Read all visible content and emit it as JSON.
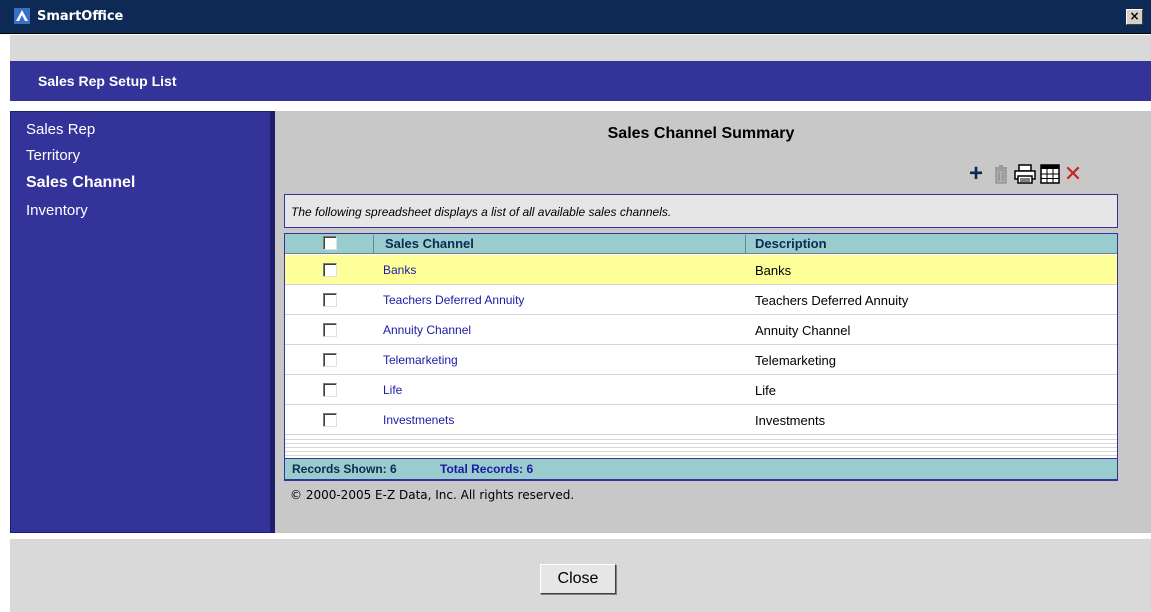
{
  "window": {
    "title": "SmartOffice",
    "close_glyph": "×"
  },
  "header": {
    "title": "Sales Rep Setup List"
  },
  "sidebar": {
    "items": [
      {
        "label": "Sales Rep",
        "active": false
      },
      {
        "label": "Territory",
        "active": false
      },
      {
        "label": "Sales Channel",
        "active": true
      },
      {
        "label": "Inventory",
        "active": false
      }
    ]
  },
  "main": {
    "title": "Sales Channel Summary",
    "toolbar": {
      "icons": [
        "add-icon",
        "trash-icon",
        "print-icon",
        "grid-icon",
        "delete-icon"
      ],
      "add_glyph": "+",
      "delete_glyph": "✕"
    },
    "info_text": "The following spreadsheet displays a list of all available sales channels."
  },
  "grid": {
    "columns": [
      "Sales Channel",
      "Description"
    ],
    "rows": [
      {
        "name": "Banks",
        "description": "Banks",
        "selected": true
      },
      {
        "name": "Teachers Deferred Annuity",
        "description": "Teachers Deferred Annuity",
        "selected": false
      },
      {
        "name": "Annuity Channel",
        "description": "Annuity Channel",
        "selected": false
      },
      {
        "name": "Telemarketing",
        "description": "Telemarketing",
        "selected": false
      },
      {
        "name": "Life",
        "description": "Life",
        "selected": false
      },
      {
        "name": "Investmenets",
        "description": "Investments",
        "selected": false
      }
    ],
    "footer": {
      "records_shown": "Records Shown: 6",
      "total_records": "Total Records: 6"
    }
  },
  "copyright": "© 2000-2005 E-Z Data, Inc. All rights reserved.",
  "buttons": {
    "close": "Close"
  },
  "colors": {
    "titlebar": "#0d2a54",
    "accent_navy": "#333399",
    "grid_header": "#99cccc",
    "row_highlight": "#ffff99",
    "link_blue": "#1a1aa6",
    "delete_red": "#cc2222"
  }
}
